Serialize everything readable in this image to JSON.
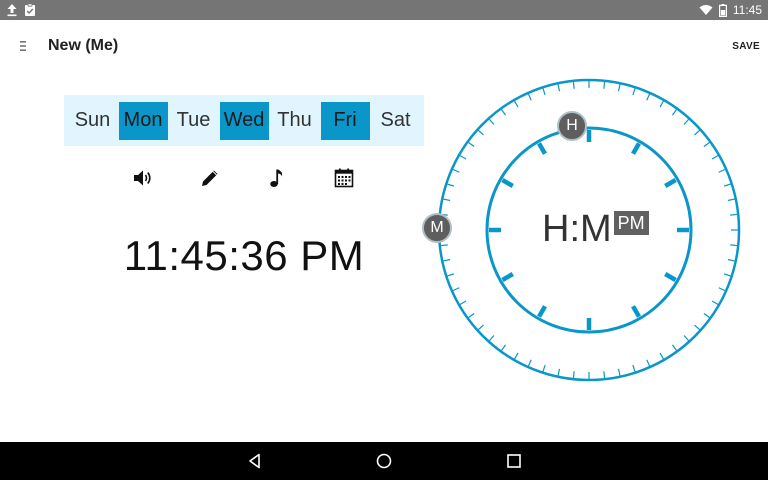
{
  "status_bar": {
    "time": "11:45",
    "left_icons": [
      "upload-icon",
      "clipboard-check-icon"
    ],
    "right_icons": [
      "wifi-icon",
      "battery-icon"
    ]
  },
  "toolbar": {
    "menu_icon": "menu-icon",
    "title": "New (Me)",
    "save_label": "SAVE"
  },
  "days": [
    {
      "label": "Sun",
      "selected": false
    },
    {
      "label": "Mon",
      "selected": true
    },
    {
      "label": "Tue",
      "selected": false
    },
    {
      "label": "Wed",
      "selected": true
    },
    {
      "label": "Thu",
      "selected": false
    },
    {
      "label": "Fri",
      "selected": true
    },
    {
      "label": "Sat",
      "selected": false
    }
  ],
  "actions": [
    "volume-icon",
    "pencil-icon",
    "music-note-icon",
    "calendar-icon"
  ],
  "time_display": "11:45:36 PM",
  "dial": {
    "center_text": "H:M",
    "ampm": "PM",
    "hour_handle_label": "H",
    "minute_handle_label": "M",
    "accent_color": "#0a96c9"
  },
  "nav_bar": [
    "back-icon",
    "home-icon",
    "recents-icon"
  ],
  "colors": {
    "status_bar": "#757575",
    "accent": "#0a96c9",
    "day_row_bg": "#e1f5fe",
    "nav_bar": "#000000"
  }
}
